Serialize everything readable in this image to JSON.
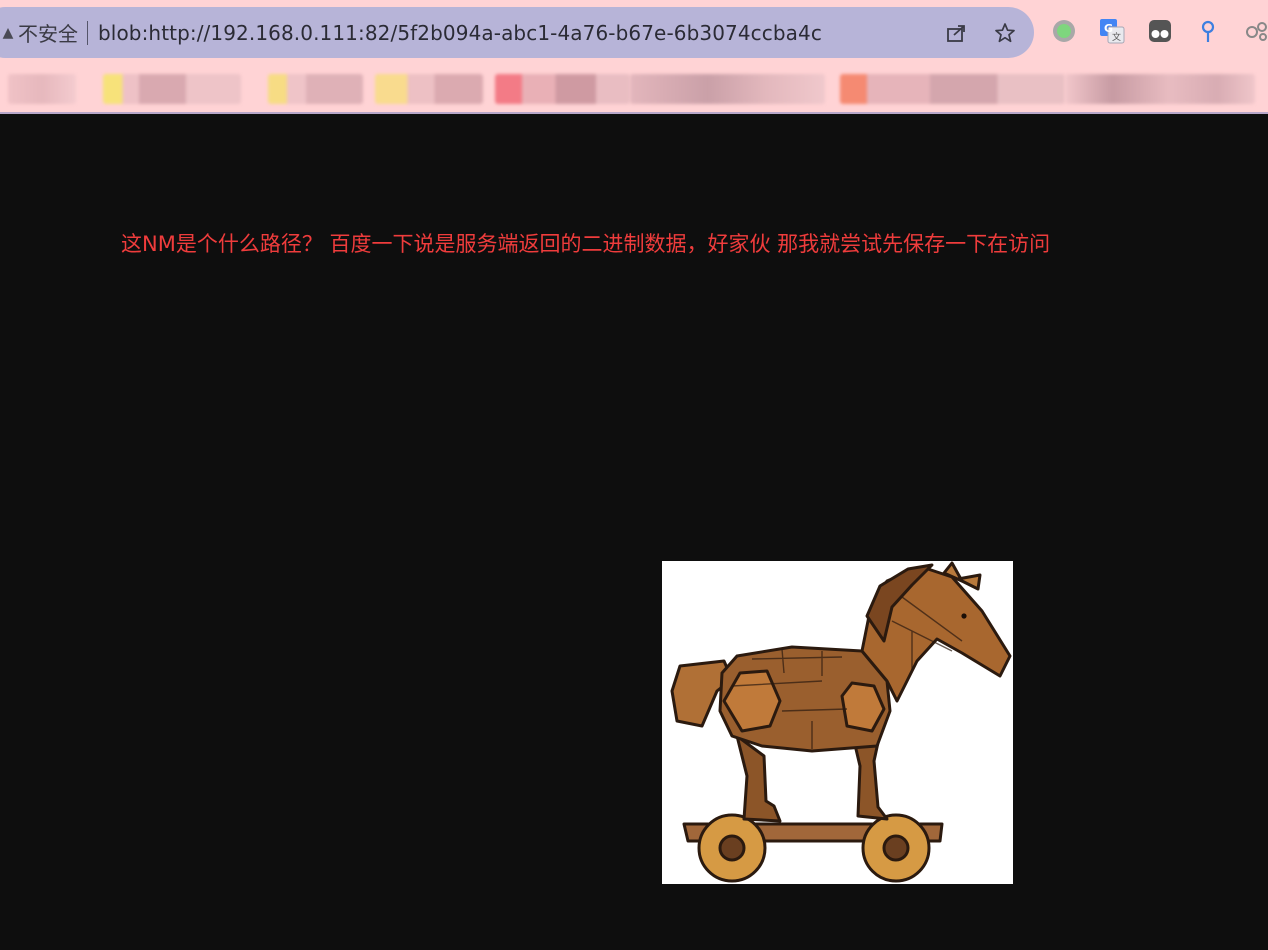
{
  "browser": {
    "security_label": "不安全",
    "url": "blob:http://192.168.0.111:82/5f2b094a-abc1-4a76-b67e-6b3074ccba4c",
    "toolbar_icons": [
      "share-icon",
      "bookmark-star-icon"
    ],
    "extension_icons": [
      "green-dot-extension-icon",
      "google-translate-icon",
      "tampermonkey-icon",
      "location-pin-icon",
      "ext-overflow-icon"
    ]
  },
  "page": {
    "message": "这NM是个什么路径？ 百度一下说是服务端返回的二进制数据，好家伙 那我就尝试先保存一下在访问",
    "image_alt": "trojan horse",
    "text_color": "#ef3c3c",
    "background": "#0e0e0e"
  }
}
